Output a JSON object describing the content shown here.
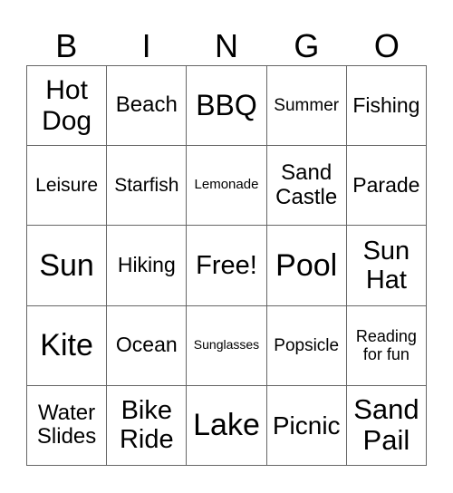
{
  "header": [
    "B",
    "I",
    "N",
    "G",
    "O"
  ],
  "cells": [
    {
      "text": "Hot Dog",
      "size": 30
    },
    {
      "text": "Beach",
      "size": 24
    },
    {
      "text": "BBQ",
      "size": 32
    },
    {
      "text": "Summer",
      "size": 19
    },
    {
      "text": "Fishing",
      "size": 23
    },
    {
      "text": "Leisure",
      "size": 21
    },
    {
      "text": "Starfish",
      "size": 21
    },
    {
      "text": "Lemonade",
      "size": 15
    },
    {
      "text": "Sand Castle",
      "size": 24
    },
    {
      "text": "Parade",
      "size": 23
    },
    {
      "text": "Sun",
      "size": 34
    },
    {
      "text": "Hiking",
      "size": 23
    },
    {
      "text": "Free!",
      "size": 29
    },
    {
      "text": "Pool",
      "size": 34
    },
    {
      "text": "Sun Hat",
      "size": 29
    },
    {
      "text": "Kite",
      "size": 34
    },
    {
      "text": "Ocean",
      "size": 23
    },
    {
      "text": "Sunglasses",
      "size": 14
    },
    {
      "text": "Popsicle",
      "size": 19
    },
    {
      "text": "Reading for fun",
      "size": 18
    },
    {
      "text": "Water Slides",
      "size": 24
    },
    {
      "text": "Bike Ride",
      "size": 29
    },
    {
      "text": "Lake",
      "size": 34
    },
    {
      "text": "Picnic",
      "size": 28
    },
    {
      "text": "Sand Pail",
      "size": 31
    }
  ]
}
